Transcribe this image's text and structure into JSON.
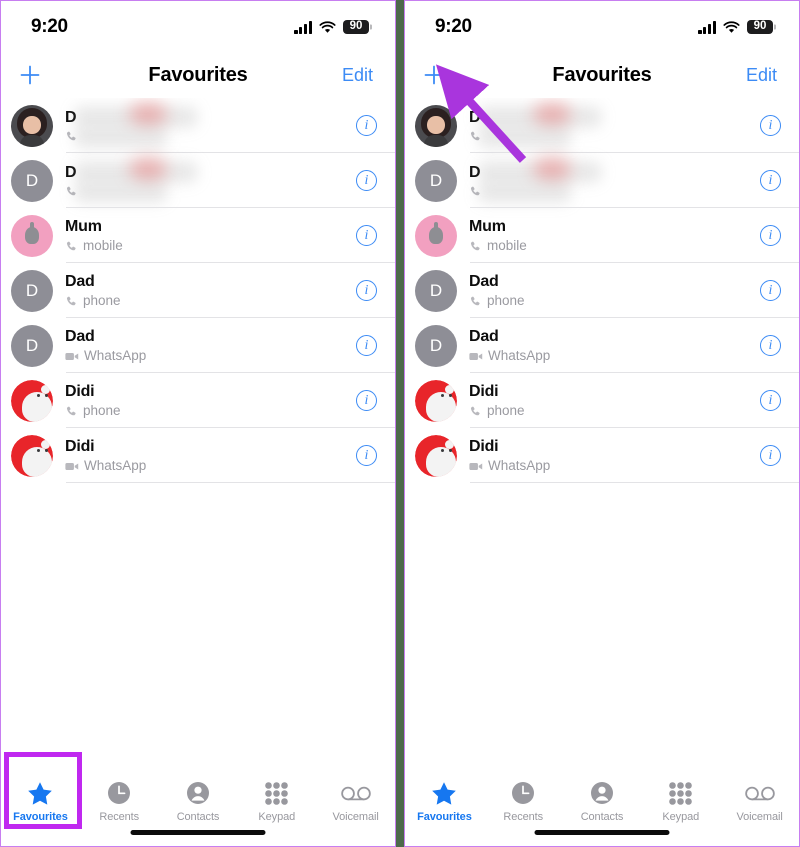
{
  "app": {
    "title": "Favourites"
  },
  "status_bar": {
    "time": "9:20",
    "battery": "90",
    "signal_icon": "cellular-bars-icon",
    "wifi_icon": "wifi-icon",
    "battery_icon": "battery-icon"
  },
  "navbar": {
    "add_label": "+",
    "title": "Favourites",
    "edit_label": "Edit",
    "add_icon": "plus-icon"
  },
  "favourites": [
    {
      "name": "D",
      "name_blurred": true,
      "subtitle": "",
      "subtitle_blurred": true,
      "channel_icon": "phone-icon",
      "avatar": "photo",
      "info_icon": "info-circle-icon"
    },
    {
      "name": "D",
      "name_blurred": true,
      "subtitle": "",
      "subtitle_blurred": true,
      "channel_icon": "phone-icon",
      "avatar": "gray-initial",
      "avatar_initial": "D",
      "info_icon": "info-circle-icon"
    },
    {
      "name": "Mum",
      "name_blurred": false,
      "subtitle": "mobile",
      "subtitle_blurred": false,
      "channel_icon": "phone-icon",
      "avatar": "pink-memoji",
      "info_icon": "info-circle-icon"
    },
    {
      "name": "Dad",
      "name_blurred": false,
      "subtitle": "phone",
      "subtitle_blurred": false,
      "channel_icon": "phone-icon",
      "avatar": "gray-initial",
      "avatar_initial": "D",
      "info_icon": "info-circle-icon"
    },
    {
      "name": "Dad",
      "name_blurred": false,
      "subtitle": "WhatsApp",
      "subtitle_blurred": false,
      "channel_icon": "video-camera-icon",
      "avatar": "gray-initial",
      "avatar_initial": "D",
      "info_icon": "info-circle-icon"
    },
    {
      "name": "Didi",
      "name_blurred": false,
      "subtitle": "phone",
      "subtitle_blurred": false,
      "channel_icon": "phone-icon",
      "avatar": "red-bear",
      "info_icon": "info-circle-icon"
    },
    {
      "name": "Didi",
      "name_blurred": false,
      "subtitle": "WhatsApp",
      "subtitle_blurred": false,
      "channel_icon": "video-camera-icon",
      "avatar": "red-bear",
      "info_icon": "info-circle-icon"
    }
  ],
  "tabbar": {
    "active": "Favourites",
    "tabs": [
      {
        "label": "Favourites",
        "icon": "star-icon"
      },
      {
        "label": "Recents",
        "icon": "clock-icon"
      },
      {
        "label": "Contacts",
        "icon": "person-circle-icon"
      },
      {
        "label": "Keypad",
        "icon": "keypad-grid-icon"
      },
      {
        "label": "Voicemail",
        "icon": "voicemail-icon"
      }
    ]
  },
  "annotations": {
    "highlight_color": "#c028f0",
    "arrow_color": "#a935dd",
    "highlight_target": "Favourites tab",
    "arrow_target": "add (+) button"
  },
  "colors": {
    "accent_blue": "#3c8bf5",
    "tab_active_blue": "#1677f0",
    "divider_green": "#4d6a4b",
    "panel_border_purple": "#c77ef0"
  }
}
